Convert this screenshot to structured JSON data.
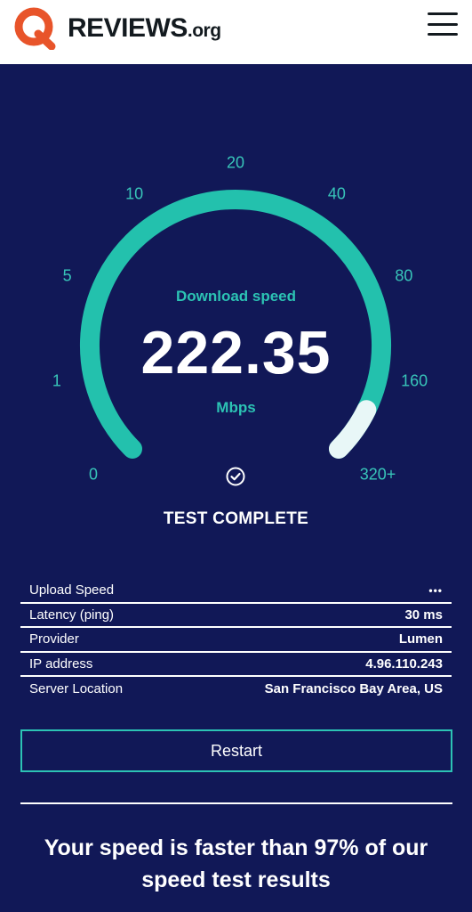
{
  "header": {
    "logo_main": "REVIEWS",
    "logo_suffix": ".org",
    "brand_color": "#e8542a"
  },
  "gauge": {
    "ticks": [
      "0",
      "1",
      "5",
      "10",
      "20",
      "40",
      "80",
      "160",
      "320+"
    ],
    "label": "Download speed",
    "value": "222.35",
    "unit": "Mbps",
    "fill_fraction": 0.93,
    "track_color": "#23c1ad",
    "fill_color": "#e8f7f7",
    "status": "TEST COMPLETE",
    "status_icon": "check-circle-icon"
  },
  "stats": [
    {
      "label": "Upload Speed",
      "value": "•••"
    },
    {
      "label": "Latency (ping)",
      "value": "30 ms"
    },
    {
      "label": "Provider",
      "value": "Lumen"
    },
    {
      "label": "IP address",
      "value": "4.96.110.243"
    },
    {
      "label": "Server Location",
      "value": "San Francisco Bay Area, US"
    }
  ],
  "restart_label": "Restart",
  "result_text": "Your speed is faster than 97% of our speed test results"
}
